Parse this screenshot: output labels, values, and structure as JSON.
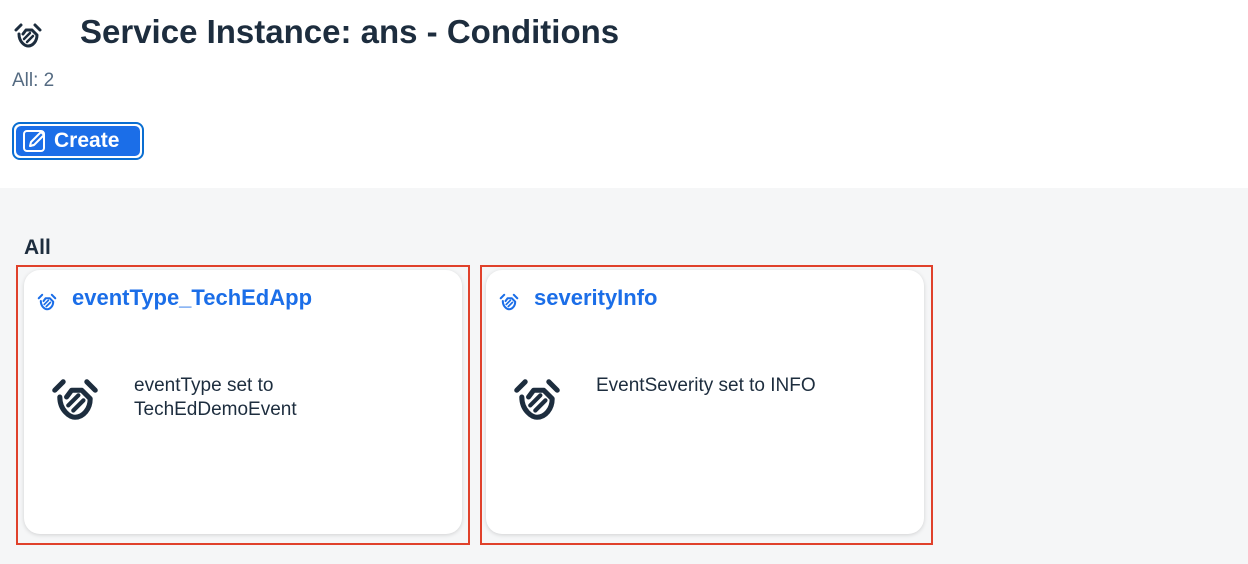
{
  "header": {
    "title": "Service Instance: ans - Conditions",
    "title_icon": "handshake-icon",
    "count": "All: 2"
  },
  "toolbar": {
    "create_label": "Create",
    "create_icon": "edit-pencil-icon"
  },
  "section": {
    "title": "All"
  },
  "cards": [
    {
      "title": "eventType_TechEdApp",
      "icon": "handshake-icon",
      "description": "eventType set to TechEdDemoEvent"
    },
    {
      "title": "severityInfo",
      "icon": "handshake-icon",
      "description": "EventSeverity set to INFO"
    }
  ],
  "colors": {
    "accent": "#1b6ee8",
    "highlight": "#e0412b",
    "text": "#1d2d3e",
    "muted": "#556b82",
    "background": "#f5f6f7"
  }
}
